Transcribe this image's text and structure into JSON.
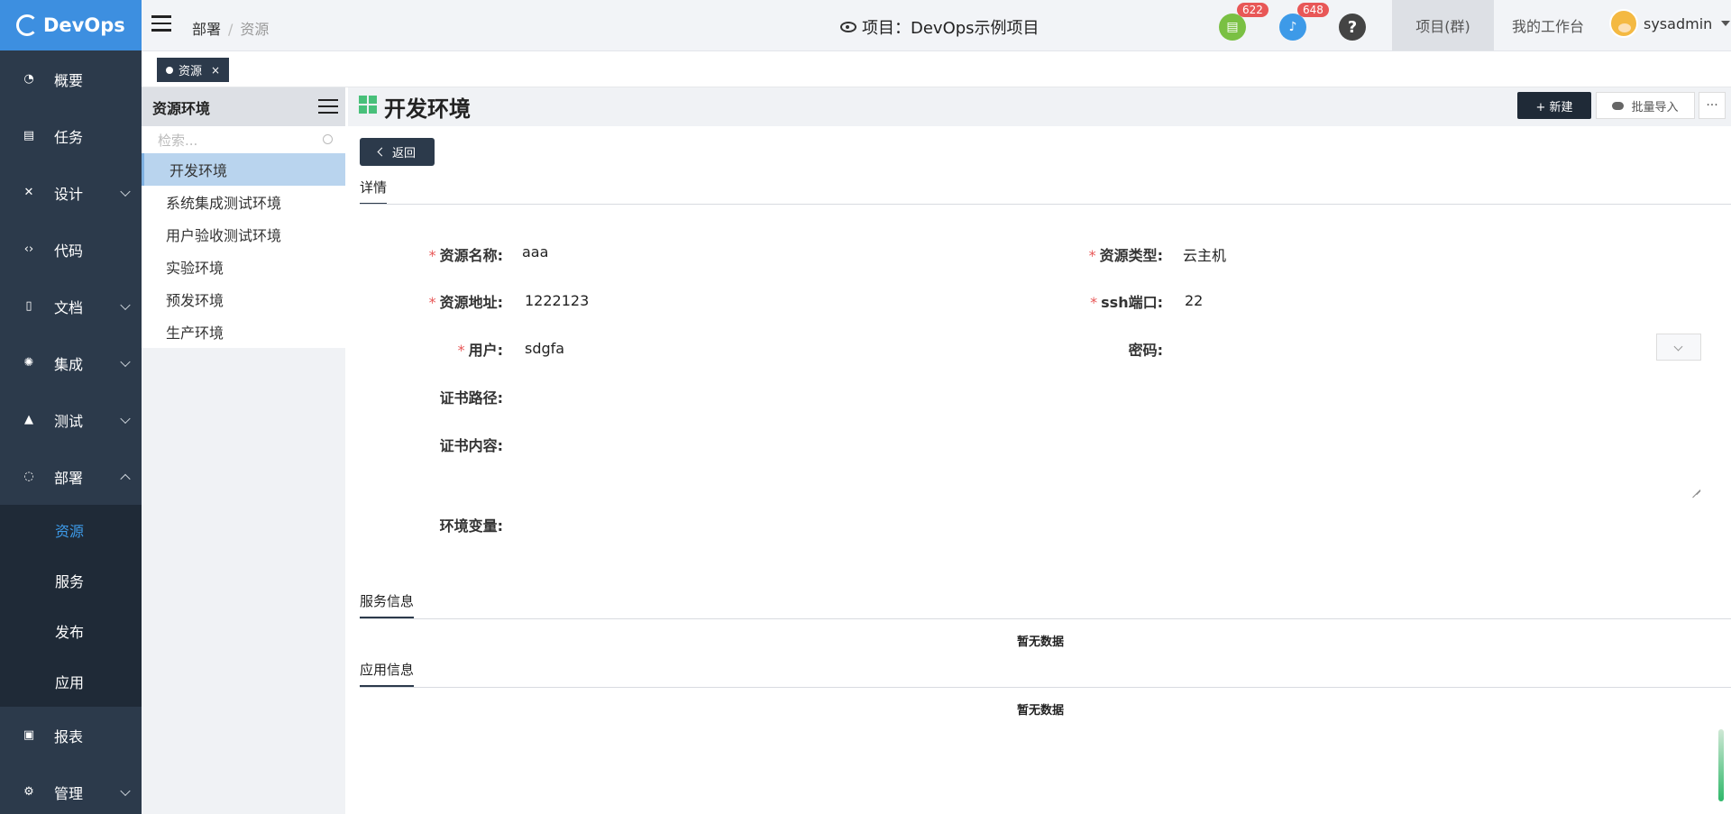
{
  "sidebar": {
    "logo_text": "DevOps",
    "items": [
      {
        "label": "概要",
        "icon": "dashboard-icon"
      },
      {
        "label": "任务",
        "icon": "task-icon"
      },
      {
        "label": "设计",
        "icon": "design-icon"
      },
      {
        "label": "代码",
        "icon": "code-icon"
      },
      {
        "label": "文档",
        "icon": "document-icon"
      },
      {
        "label": "集成",
        "icon": "integration-icon"
      },
      {
        "label": "测试",
        "icon": "flask-icon"
      },
      {
        "label": "部署",
        "icon": "deploy-icon"
      },
      {
        "label": "报表",
        "icon": "report-icon"
      },
      {
        "label": "管理",
        "icon": "gear-icon"
      }
    ],
    "deploy_sub": [
      "资源",
      "服务",
      "发布",
      "应用"
    ],
    "active_sub": "资源"
  },
  "header": {
    "breadcrumb": [
      "部署",
      "资源"
    ],
    "project_title": "项目：DevOps示例项目",
    "badge_doc": "622",
    "badge_bell": "648",
    "help": "?",
    "nav_project": "项目(群)",
    "nav_workspace": "我的工作台",
    "username": "sysadmin"
  },
  "tabbar": {
    "tab_label": "资源",
    "close": "×"
  },
  "left_panel": {
    "title": "资源环境",
    "search_placeholder": "检索...",
    "items": [
      "开发环境",
      "系统集成测试环境",
      "用户验收测试环境",
      "实验环境",
      "预发环境",
      "生产环境"
    ],
    "active": "开发环境"
  },
  "main": {
    "title": "开发环境",
    "btn_new": "+ 新建",
    "btn_import": "批量导入",
    "btn_more": "···",
    "btn_back": "返回",
    "detail_tab": "详情",
    "fields": {
      "name_label": "资源名称:",
      "name_value": "aaa",
      "type_label": "资源类型:",
      "type_value": "云主机",
      "addr_label": "资源地址:",
      "addr_value": "1222123",
      "ssh_label": "ssh端口:",
      "ssh_value": "22",
      "user_label": "用户:",
      "user_value": "sdgfa",
      "pwd_label": "密码:",
      "cert_path_label": "证书路径:",
      "cert_content_label": "证书内容:",
      "env_label": "环境变量:"
    },
    "required_mark": "*",
    "service_tab": "服务信息",
    "service_empty": "暂无数据",
    "app_tab": "应用信息",
    "app_empty": "暂无数据"
  },
  "colors": {
    "sidebar_bg": "#2c3a4b",
    "logo_bg": "#3d8fe0",
    "active_item": "#b9d4ee",
    "required": "#e85757"
  }
}
